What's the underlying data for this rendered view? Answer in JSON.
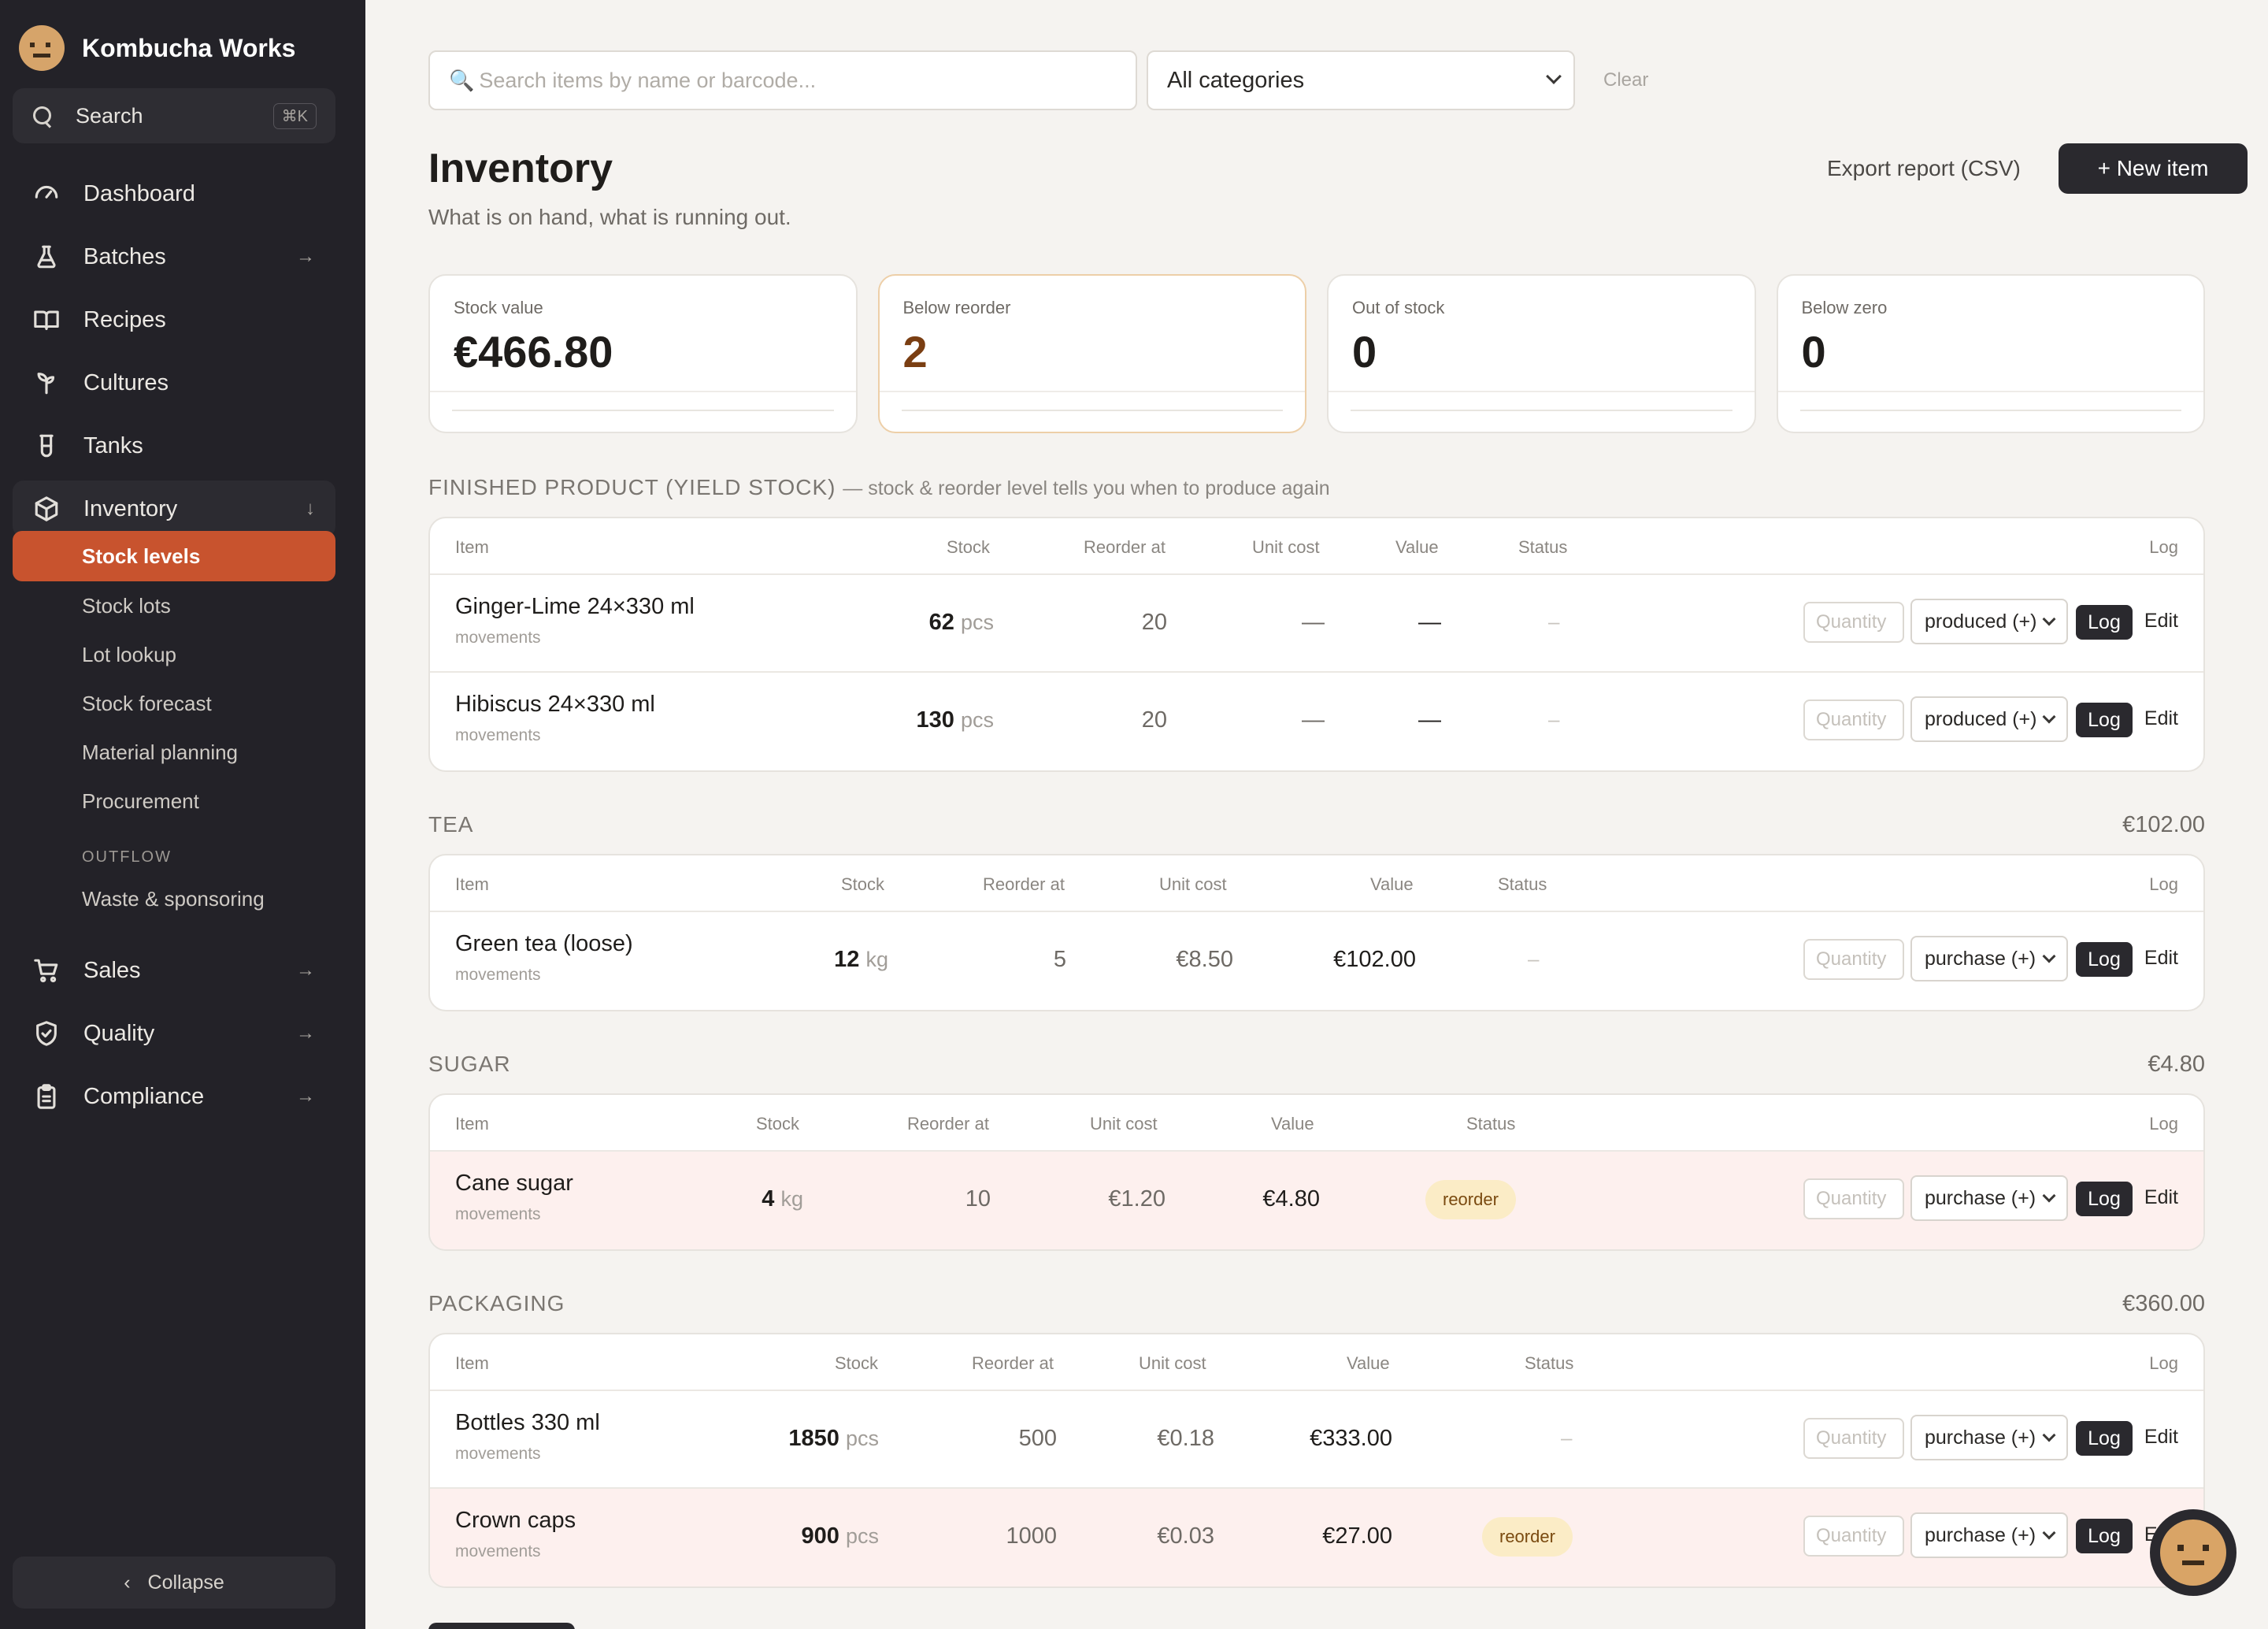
{
  "app": {
    "name": "Kombucha Works"
  },
  "sidebar": {
    "search_label": "Search",
    "search_shortcut": "⌘K",
    "nav_top": [
      {
        "label": "Dashboard",
        "icon": "gauge-icon"
      },
      {
        "label": "Batches",
        "icon": "flask-icon",
        "arrow": "→"
      },
      {
        "label": "Recipes",
        "icon": "book-icon"
      },
      {
        "label": "Cultures",
        "icon": "sprout-icon"
      },
      {
        "label": "Tanks",
        "icon": "beaker-icon"
      },
      {
        "label": "Inventory",
        "icon": "box-icon",
        "arrow": "↓"
      }
    ],
    "inventory_sub": [
      "Stock levels",
      "Stock lots",
      "Lot lookup",
      "Stock forecast",
      "Material planning",
      "Procurement"
    ],
    "outflow_heading": "OUTFLOW",
    "outflow_items": [
      "Waste & sponsoring"
    ],
    "nav_bottom": [
      {
        "label": "Sales",
        "icon": "cart-icon",
        "arrow": "→"
      },
      {
        "label": "Quality",
        "icon": "shield-check-icon",
        "arrow": "→"
      },
      {
        "label": "Compliance",
        "icon": "clipboard-icon",
        "arrow": "→"
      }
    ],
    "collapse_label": "Collapse"
  },
  "toolbar": {
    "search_placeholder": "Search items by name or barcode...",
    "category_value": "All categories",
    "clear_label": "Clear"
  },
  "page": {
    "title": "Inventory",
    "subtitle": "What is on hand, what is running out.",
    "export_label": "Export report (CSV)",
    "new_item_label": "+ New item"
  },
  "cards": [
    {
      "label": "Stock value",
      "value": "€466.80"
    },
    {
      "label": "Below reorder",
      "value": "2"
    },
    {
      "label": "Out of stock",
      "value": "0"
    },
    {
      "label": "Below zero",
      "value": "0"
    }
  ],
  "columns": {
    "item": "Item",
    "stock": "Stock",
    "reorder": "Reorder at",
    "unit_cost": "Unit cost",
    "value": "Value",
    "status": "Status",
    "log": "Log"
  },
  "row_common": {
    "movements": "movements",
    "qty_placeholder": "Quantity",
    "log_label": "Log",
    "edit_label": "Edit",
    "dash": "—",
    "faint_dash": "–"
  },
  "sections": {
    "finished": {
      "title": "FINISHED PRODUCT (YIELD STOCK)",
      "note": "— stock & reorder level tells you when to produce again",
      "rows": [
        {
          "name": "Ginger-Lime 24×330 ml",
          "stock": "62",
          "unit": "pcs",
          "reorder": "20",
          "movement": "produced (+)"
        },
        {
          "name": "Hibiscus 24×330 ml",
          "stock": "130",
          "unit": "pcs",
          "reorder": "20",
          "movement": "produced (+)"
        }
      ]
    },
    "tea": {
      "title": "TEA",
      "total": "€102.00",
      "rows": [
        {
          "name": "Green tea (loose)",
          "stock": "12",
          "unit": "kg",
          "reorder": "5",
          "unit_cost": "€8.50",
          "value": "€102.00",
          "movement": "purchase (+)"
        }
      ]
    },
    "sugar": {
      "title": "SUGAR",
      "total": "€4.80",
      "rows": [
        {
          "name": "Cane sugar",
          "stock": "4",
          "unit": "kg",
          "reorder": "10",
          "unit_cost": "€1.20",
          "value": "€4.80",
          "status": "reorder",
          "movement": "purchase (+)"
        }
      ]
    },
    "packaging": {
      "title": "PACKAGING",
      "total": "€360.00",
      "rows": [
        {
          "name": "Bottles 330 ml",
          "stock": "1850",
          "unit": "pcs",
          "reorder": "500",
          "unit_cost": "€0.18",
          "value": "€333.00",
          "movement": "purchase (+)"
        },
        {
          "name": "Crown caps",
          "stock": "900",
          "unit": "pcs",
          "reorder": "1000",
          "unit_cost": "€0.03",
          "value": "€27.00",
          "status": "reorder",
          "movement": "purchase (+)"
        }
      ]
    }
  },
  "colors": {
    "sidebar_bg": "#232228",
    "accent": "#c8532e",
    "dark_button": "#2a292e",
    "reorder_badge": "#fbecc6",
    "alert_row": "#fdf0ee"
  }
}
